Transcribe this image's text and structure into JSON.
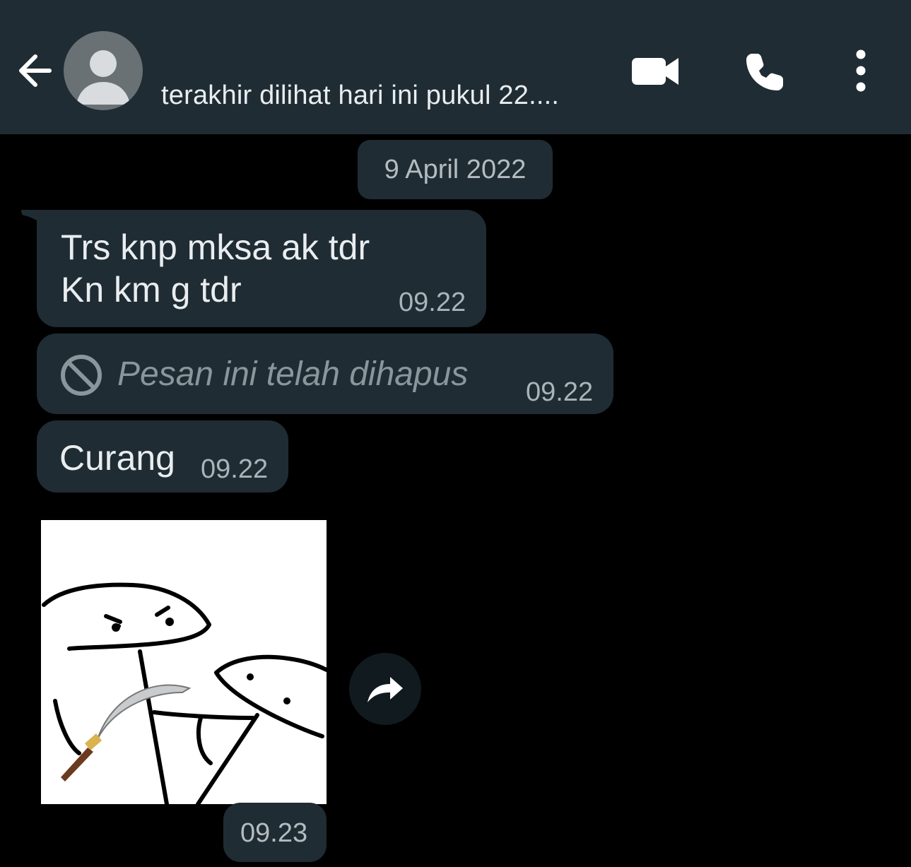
{
  "header": {
    "status": "terakhir dilihat hari ini pukul 22....",
    "icons": {
      "back": "arrow-left-icon",
      "avatar": "person-avatar",
      "video": "video-call-icon",
      "call": "phone-icon",
      "menu": "more-vertical-icon"
    }
  },
  "chat": {
    "date": "9 April 2022",
    "messages": [
      {
        "lines": [
          "Trs knp mksa ak tdr",
          "Kn km g tdr"
        ],
        "time": "09.22"
      },
      {
        "deleted_text": "Pesan ini telah dihapus",
        "time": "09.22",
        "icon": "block-icon"
      },
      {
        "text": "Curang",
        "time": "09.22"
      },
      {
        "type": "sticker",
        "time": "09.23",
        "forward_icon": "forward-icon"
      }
    ]
  },
  "colors": {
    "header_bg": "#1f2c34",
    "bubble_bg": "#1f2c34",
    "chat_bg": "#000000",
    "text": "#e9edef",
    "muted": "#aab4b9"
  }
}
